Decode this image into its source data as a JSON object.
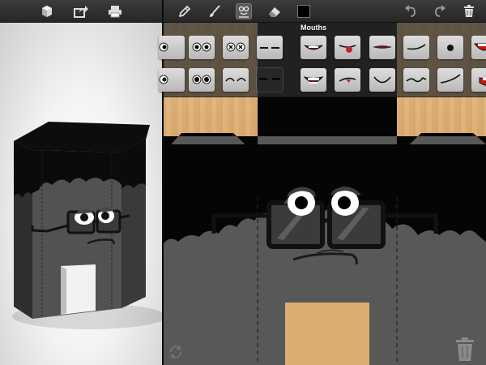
{
  "left_toolbar": {
    "icons": [
      "cube-icon",
      "share-icon",
      "print-icon"
    ]
  },
  "right_toolbar": {
    "tools": [
      "pencil-icon",
      "brush-icon",
      "stamp-tool-icon",
      "eraser-icon"
    ],
    "active_tool": "stamp-tool-icon",
    "current_color": "#000000",
    "actions": [
      "undo-icon",
      "redo-icon",
      "trash-icon"
    ]
  },
  "picker": {
    "category": "Mouths",
    "tiles_row1": [
      "eyes-cut-left",
      "eyes-round",
      "eyes-crossed-x",
      "eyes-dash",
      "mouth-smile-teeth",
      "mouth-tongue",
      "mouth-flat-lips",
      "mouth-smirk-line",
      "mouth-small-o",
      "mouth-open-red"
    ],
    "tiles_row2": [
      "eyes-cut-left-2",
      "eyes-dots",
      "eyes-arched",
      "eyes-sleepy",
      "mouth-grin-teeth",
      "mouth-sneer",
      "mouth-smile-curve",
      "mouth-wavy",
      "mouth-curved-line",
      "mouth-side-red"
    ],
    "selected_tile": "eyes-sleepy"
  },
  "colors": {
    "toolbar": "#2d2d2d",
    "character": "#5a5a5a",
    "wood": "#dcae72"
  }
}
